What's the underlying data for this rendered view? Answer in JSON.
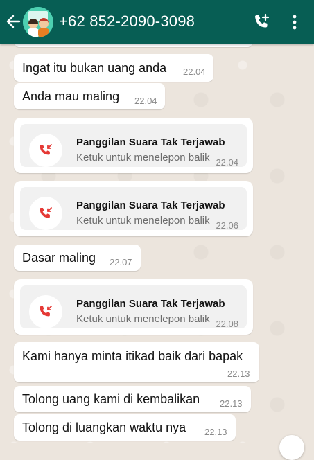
{
  "header": {
    "title": "+62 852-2090-3098",
    "colors": {
      "bar": "#075e54",
      "missed_call": "#e53935"
    }
  },
  "messages": [
    {
      "text": "Ingat itu bukan uang anda",
      "time": "22.04"
    },
    {
      "text": "Anda mau maling",
      "time": "22.04"
    },
    {
      "type": "missed_call",
      "title": "Panggilan Suara Tak Terjawab",
      "subtitle": "Ketuk untuk menelepon balik",
      "time": "22.04"
    },
    {
      "type": "missed_call",
      "title": "Panggilan Suara Tak Terjawab",
      "subtitle": "Ketuk untuk menelepon balik",
      "time": "22.06"
    },
    {
      "text": "Dasar maling",
      "time": "22.07"
    },
    {
      "type": "missed_call",
      "title": "Panggilan Suara Tak Terjawab",
      "subtitle": "Ketuk untuk menelepon balik",
      "time": "22.08"
    },
    {
      "text": "Kami hanya minta itikad baik dari bapak",
      "time": "22.13"
    },
    {
      "text": "Tolong uang kami di kembalikan",
      "time": "22.13"
    },
    {
      "text": "Tolong di luangkan waktu nya",
      "time": "22.13"
    }
  ]
}
